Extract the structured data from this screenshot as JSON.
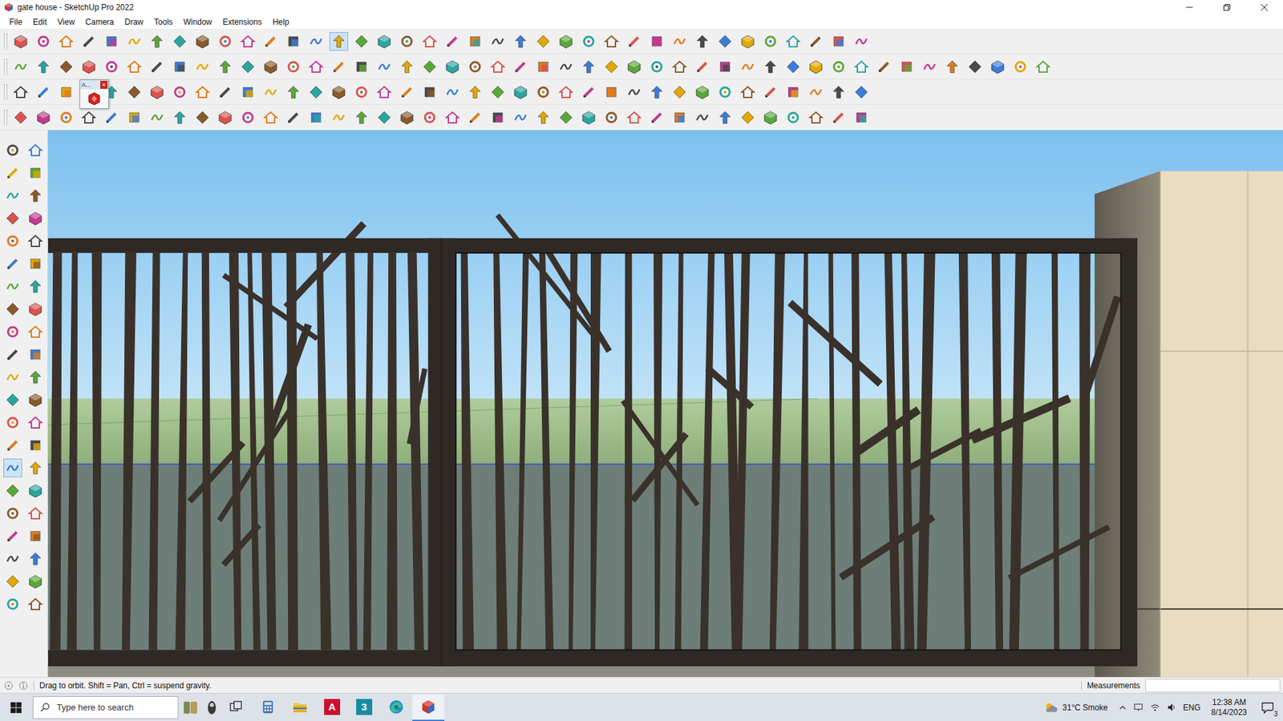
{
  "window": {
    "title": "gate house - SketchUp Pro 2022"
  },
  "menu": [
    "File",
    "Edit",
    "View",
    "Camera",
    "Draw",
    "Tools",
    "Window",
    "Extensions",
    "Help"
  ],
  "toolbars": [
    {
      "tools": [
        {
          "selected": false
        },
        {
          "selected": false
        },
        {
          "selected": false
        },
        {
          "selected": false
        },
        {
          "selected": false
        },
        {
          "selected": false
        },
        {
          "selected": false
        },
        {
          "selected": false
        },
        {
          "selected": false
        },
        {
          "selected": false
        },
        {
          "selected": false
        },
        {
          "selected": false
        },
        {
          "selected": false
        },
        {
          "selected": false
        },
        {
          "selected": true
        },
        {
          "selected": false
        },
        {
          "selected": false
        },
        {
          "selected": false
        },
        {
          "selected": false
        },
        {
          "selected": false
        },
        {
          "selected": false
        },
        {
          "selected": false
        },
        {
          "selected": false
        },
        {
          "selected": false
        },
        {
          "selected": false
        },
        {
          "selected": false
        },
        {
          "selected": false
        },
        {
          "selected": false
        },
        {
          "selected": false
        },
        {
          "selected": false
        },
        {
          "selected": false
        },
        {
          "selected": false
        },
        {
          "selected": false
        },
        {
          "selected": false
        },
        {
          "selected": false
        },
        {
          "selected": false
        },
        {
          "selected": false
        },
        {
          "selected": false
        }
      ]
    },
    {
      "tools": [
        {
          "selected": false
        },
        {
          "selected": false
        },
        {
          "selected": false
        },
        {
          "selected": false
        },
        {
          "selected": false
        },
        {
          "selected": false
        },
        {
          "selected": false
        },
        {
          "selected": false
        },
        {
          "selected": false
        },
        {
          "selected": false
        },
        {
          "selected": false
        },
        {
          "selected": false
        },
        {
          "selected": false
        },
        {
          "selected": false
        },
        {
          "selected": false
        },
        {
          "selected": false
        },
        {
          "selected": false
        },
        {
          "selected": false
        },
        {
          "selected": false
        },
        {
          "selected": false
        },
        {
          "selected": false
        },
        {
          "selected": false
        },
        {
          "selected": false
        },
        {
          "selected": false
        },
        {
          "selected": false
        },
        {
          "selected": false
        },
        {
          "selected": false
        },
        {
          "selected": false
        },
        {
          "selected": false
        },
        {
          "selected": false
        },
        {
          "selected": false
        },
        {
          "selected": false
        },
        {
          "selected": false
        },
        {
          "selected": false
        },
        {
          "selected": false
        },
        {
          "selected": false
        },
        {
          "selected": false
        },
        {
          "selected": false
        },
        {
          "selected": false
        },
        {
          "selected": false
        },
        {
          "selected": false
        },
        {
          "selected": false
        },
        {
          "selected": false
        },
        {
          "selected": false
        },
        {
          "selected": false
        },
        {
          "selected": false
        }
      ]
    },
    {
      "tools": [
        {
          "selected": false
        },
        {
          "selected": false
        },
        {
          "selected": false
        },
        {
          "selected": false
        },
        {
          "selected": false
        },
        {
          "selected": false
        },
        {
          "selected": false
        },
        {
          "selected": false
        },
        {
          "selected": false
        },
        {
          "selected": false
        },
        {
          "selected": false
        },
        {
          "selected": false
        },
        {
          "selected": false
        },
        {
          "selected": false
        },
        {
          "selected": false
        },
        {
          "selected": false
        },
        {
          "selected": false
        },
        {
          "selected": false
        },
        {
          "selected": false
        },
        {
          "selected": false
        },
        {
          "selected": false
        },
        {
          "selected": false
        },
        {
          "selected": false
        },
        {
          "selected": false
        },
        {
          "selected": false
        },
        {
          "selected": false
        },
        {
          "selected": false
        },
        {
          "selected": false
        },
        {
          "selected": false
        },
        {
          "selected": false
        },
        {
          "selected": false
        },
        {
          "selected": false
        },
        {
          "selected": false
        },
        {
          "selected": false
        },
        {
          "selected": false
        },
        {
          "selected": false
        },
        {
          "selected": false
        },
        {
          "selected": false
        }
      ]
    },
    {
      "tools": [
        {
          "selected": false
        },
        {
          "selected": false
        },
        {
          "selected": false
        },
        {
          "selected": false
        },
        {
          "selected": false
        },
        {
          "selected": false
        },
        {
          "selected": false
        },
        {
          "selected": false
        },
        {
          "selected": false
        },
        {
          "selected": false
        },
        {
          "selected": false
        },
        {
          "selected": false
        },
        {
          "selected": false
        },
        {
          "selected": false
        },
        {
          "selected": false
        },
        {
          "selected": false
        },
        {
          "selected": false
        },
        {
          "selected": false
        },
        {
          "selected": false
        },
        {
          "selected": false
        },
        {
          "selected": false
        },
        {
          "selected": false
        },
        {
          "selected": false
        },
        {
          "selected": false
        },
        {
          "selected": false
        },
        {
          "selected": false
        },
        {
          "selected": false
        },
        {
          "selected": false
        },
        {
          "selected": false
        },
        {
          "selected": false
        },
        {
          "selected": false
        },
        {
          "selected": false
        },
        {
          "selected": false
        },
        {
          "selected": false
        },
        {
          "selected": false
        },
        {
          "selected": false
        },
        {
          "selected": false
        },
        {
          "selected": false
        }
      ]
    }
  ],
  "floating_toolbar": {
    "title": "A...",
    "close": "×"
  },
  "left_toolbar": {
    "tools": [
      {
        "selected": false
      },
      {
        "selected": false
      },
      {
        "selected": false
      },
      {
        "selected": false
      },
      {
        "selected": false
      },
      {
        "selected": false
      },
      {
        "selected": false
      },
      {
        "selected": false
      },
      {
        "selected": false
      },
      {
        "selected": false
      },
      {
        "selected": false
      },
      {
        "selected": false
      },
      {
        "selected": false
      },
      {
        "selected": false
      },
      {
        "selected": false
      },
      {
        "selected": false
      },
      {
        "selected": false
      },
      {
        "selected": false
      },
      {
        "selected": false
      },
      {
        "selected": false
      },
      {
        "selected": false
      },
      {
        "selected": false
      },
      {
        "selected": false
      },
      {
        "selected": false
      },
      {
        "selected": false
      },
      {
        "selected": false
      },
      {
        "selected": false
      },
      {
        "selected": false
      },
      {
        "selected": true
      },
      {
        "selected": false
      },
      {
        "selected": false
      },
      {
        "selected": false
      },
      {
        "selected": false
      },
      {
        "selected": false
      },
      {
        "selected": false
      },
      {
        "selected": false
      },
      {
        "selected": false
      },
      {
        "selected": false
      },
      {
        "selected": false
      },
      {
        "selected": false
      },
      {
        "selected": false
      },
      {
        "selected": false
      }
    ]
  },
  "status_bar": {
    "hint": "Drag to orbit. Shift = Pan, Ctrl = suspend gravity.",
    "measurements_label": "Measurements"
  },
  "taskbar": {
    "search_placeholder": "Type here to search",
    "apps": [
      {
        "kind": "taskview",
        "active": false
      },
      {
        "kind": "calculator",
        "active": false
      },
      {
        "kind": "explorer",
        "active": false
      },
      {
        "kind": "autocad",
        "label": "A",
        "active": false
      },
      {
        "kind": "max",
        "label": "3",
        "active": false
      },
      {
        "kind": "edge",
        "active": false
      },
      {
        "kind": "sketchup",
        "active": true
      }
    ],
    "weather": "31°C Smoke",
    "language": "ENG",
    "time": "12:38 AM",
    "date": "8/14/2023",
    "notifications": "3"
  }
}
